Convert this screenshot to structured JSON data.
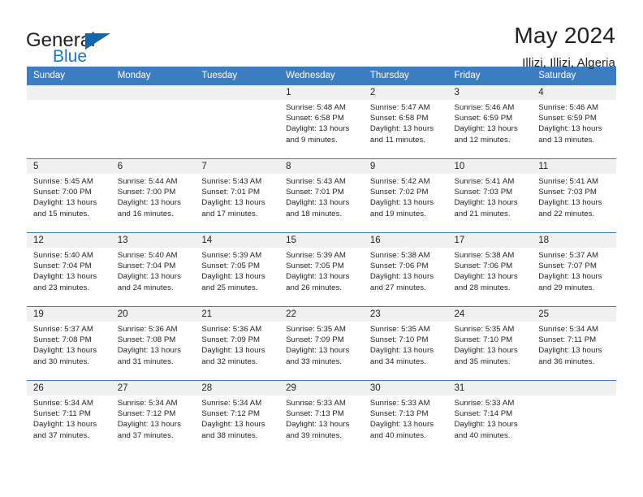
{
  "brand": {
    "name_part1": "General",
    "name_part2": "Blue",
    "logo_icon": "triangle-logo-icon"
  },
  "header": {
    "title": "May 2024",
    "subtitle": "Illizi, Illizi, Algeria"
  },
  "colors": {
    "header_blue": "#3b7dc0",
    "brand_blue": "#1878be",
    "daynum_bg": "#f0f0f0",
    "text": "#231f20"
  },
  "calendar": {
    "weekday_headers": [
      "Sunday",
      "Monday",
      "Tuesday",
      "Wednesday",
      "Thursday",
      "Friday",
      "Saturday"
    ],
    "weeks": [
      [
        {
          "day": "",
          "empty": true
        },
        {
          "day": "",
          "empty": true
        },
        {
          "day": "",
          "empty": true
        },
        {
          "day": "1",
          "sunrise": "Sunrise: 5:48 AM",
          "sunset": "Sunset: 6:58 PM",
          "daylight_line1": "Daylight: 13 hours",
          "daylight_line2": "and 9 minutes."
        },
        {
          "day": "2",
          "sunrise": "Sunrise: 5:47 AM",
          "sunset": "Sunset: 6:58 PM",
          "daylight_line1": "Daylight: 13 hours",
          "daylight_line2": "and 11 minutes."
        },
        {
          "day": "3",
          "sunrise": "Sunrise: 5:46 AM",
          "sunset": "Sunset: 6:59 PM",
          "daylight_line1": "Daylight: 13 hours",
          "daylight_line2": "and 12 minutes."
        },
        {
          "day": "4",
          "sunrise": "Sunrise: 5:46 AM",
          "sunset": "Sunset: 6:59 PM",
          "daylight_line1": "Daylight: 13 hours",
          "daylight_line2": "and 13 minutes."
        }
      ],
      [
        {
          "day": "5",
          "sunrise": "Sunrise: 5:45 AM",
          "sunset": "Sunset: 7:00 PM",
          "daylight_line1": "Daylight: 13 hours",
          "daylight_line2": "and 15 minutes."
        },
        {
          "day": "6",
          "sunrise": "Sunrise: 5:44 AM",
          "sunset": "Sunset: 7:00 PM",
          "daylight_line1": "Daylight: 13 hours",
          "daylight_line2": "and 16 minutes."
        },
        {
          "day": "7",
          "sunrise": "Sunrise: 5:43 AM",
          "sunset": "Sunset: 7:01 PM",
          "daylight_line1": "Daylight: 13 hours",
          "daylight_line2": "and 17 minutes."
        },
        {
          "day": "8",
          "sunrise": "Sunrise: 5:43 AM",
          "sunset": "Sunset: 7:01 PM",
          "daylight_line1": "Daylight: 13 hours",
          "daylight_line2": "and 18 minutes."
        },
        {
          "day": "9",
          "sunrise": "Sunrise: 5:42 AM",
          "sunset": "Sunset: 7:02 PM",
          "daylight_line1": "Daylight: 13 hours",
          "daylight_line2": "and 19 minutes."
        },
        {
          "day": "10",
          "sunrise": "Sunrise: 5:41 AM",
          "sunset": "Sunset: 7:03 PM",
          "daylight_line1": "Daylight: 13 hours",
          "daylight_line2": "and 21 minutes."
        },
        {
          "day": "11",
          "sunrise": "Sunrise: 5:41 AM",
          "sunset": "Sunset: 7:03 PM",
          "daylight_line1": "Daylight: 13 hours",
          "daylight_line2": "and 22 minutes."
        }
      ],
      [
        {
          "day": "12",
          "sunrise": "Sunrise: 5:40 AM",
          "sunset": "Sunset: 7:04 PM",
          "daylight_line1": "Daylight: 13 hours",
          "daylight_line2": "and 23 minutes."
        },
        {
          "day": "13",
          "sunrise": "Sunrise: 5:40 AM",
          "sunset": "Sunset: 7:04 PM",
          "daylight_line1": "Daylight: 13 hours",
          "daylight_line2": "and 24 minutes."
        },
        {
          "day": "14",
          "sunrise": "Sunrise: 5:39 AM",
          "sunset": "Sunset: 7:05 PM",
          "daylight_line1": "Daylight: 13 hours",
          "daylight_line2": "and 25 minutes."
        },
        {
          "day": "15",
          "sunrise": "Sunrise: 5:39 AM",
          "sunset": "Sunset: 7:05 PM",
          "daylight_line1": "Daylight: 13 hours",
          "daylight_line2": "and 26 minutes."
        },
        {
          "day": "16",
          "sunrise": "Sunrise: 5:38 AM",
          "sunset": "Sunset: 7:06 PM",
          "daylight_line1": "Daylight: 13 hours",
          "daylight_line2": "and 27 minutes."
        },
        {
          "day": "17",
          "sunrise": "Sunrise: 5:38 AM",
          "sunset": "Sunset: 7:06 PM",
          "daylight_line1": "Daylight: 13 hours",
          "daylight_line2": "and 28 minutes."
        },
        {
          "day": "18",
          "sunrise": "Sunrise: 5:37 AM",
          "sunset": "Sunset: 7:07 PM",
          "daylight_line1": "Daylight: 13 hours",
          "daylight_line2": "and 29 minutes."
        }
      ],
      [
        {
          "day": "19",
          "sunrise": "Sunrise: 5:37 AM",
          "sunset": "Sunset: 7:08 PM",
          "daylight_line1": "Daylight: 13 hours",
          "daylight_line2": "and 30 minutes."
        },
        {
          "day": "20",
          "sunrise": "Sunrise: 5:36 AM",
          "sunset": "Sunset: 7:08 PM",
          "daylight_line1": "Daylight: 13 hours",
          "daylight_line2": "and 31 minutes."
        },
        {
          "day": "21",
          "sunrise": "Sunrise: 5:36 AM",
          "sunset": "Sunset: 7:09 PM",
          "daylight_line1": "Daylight: 13 hours",
          "daylight_line2": "and 32 minutes."
        },
        {
          "day": "22",
          "sunrise": "Sunrise: 5:35 AM",
          "sunset": "Sunset: 7:09 PM",
          "daylight_line1": "Daylight: 13 hours",
          "daylight_line2": "and 33 minutes."
        },
        {
          "day": "23",
          "sunrise": "Sunrise: 5:35 AM",
          "sunset": "Sunset: 7:10 PM",
          "daylight_line1": "Daylight: 13 hours",
          "daylight_line2": "and 34 minutes."
        },
        {
          "day": "24",
          "sunrise": "Sunrise: 5:35 AM",
          "sunset": "Sunset: 7:10 PM",
          "daylight_line1": "Daylight: 13 hours",
          "daylight_line2": "and 35 minutes."
        },
        {
          "day": "25",
          "sunrise": "Sunrise: 5:34 AM",
          "sunset": "Sunset: 7:11 PM",
          "daylight_line1": "Daylight: 13 hours",
          "daylight_line2": "and 36 minutes."
        }
      ],
      [
        {
          "day": "26",
          "sunrise": "Sunrise: 5:34 AM",
          "sunset": "Sunset: 7:11 PM",
          "daylight_line1": "Daylight: 13 hours",
          "daylight_line2": "and 37 minutes."
        },
        {
          "day": "27",
          "sunrise": "Sunrise: 5:34 AM",
          "sunset": "Sunset: 7:12 PM",
          "daylight_line1": "Daylight: 13 hours",
          "daylight_line2": "and 37 minutes."
        },
        {
          "day": "28",
          "sunrise": "Sunrise: 5:34 AM",
          "sunset": "Sunset: 7:12 PM",
          "daylight_line1": "Daylight: 13 hours",
          "daylight_line2": "and 38 minutes."
        },
        {
          "day": "29",
          "sunrise": "Sunrise: 5:33 AM",
          "sunset": "Sunset: 7:13 PM",
          "daylight_line1": "Daylight: 13 hours",
          "daylight_line2": "and 39 minutes."
        },
        {
          "day": "30",
          "sunrise": "Sunrise: 5:33 AM",
          "sunset": "Sunset: 7:13 PM",
          "daylight_line1": "Daylight: 13 hours",
          "daylight_line2": "and 40 minutes."
        },
        {
          "day": "31",
          "sunrise": "Sunrise: 5:33 AM",
          "sunset": "Sunset: 7:14 PM",
          "daylight_line1": "Daylight: 13 hours",
          "daylight_line2": "and 40 minutes."
        },
        {
          "day": "",
          "empty": true
        }
      ]
    ]
  }
}
